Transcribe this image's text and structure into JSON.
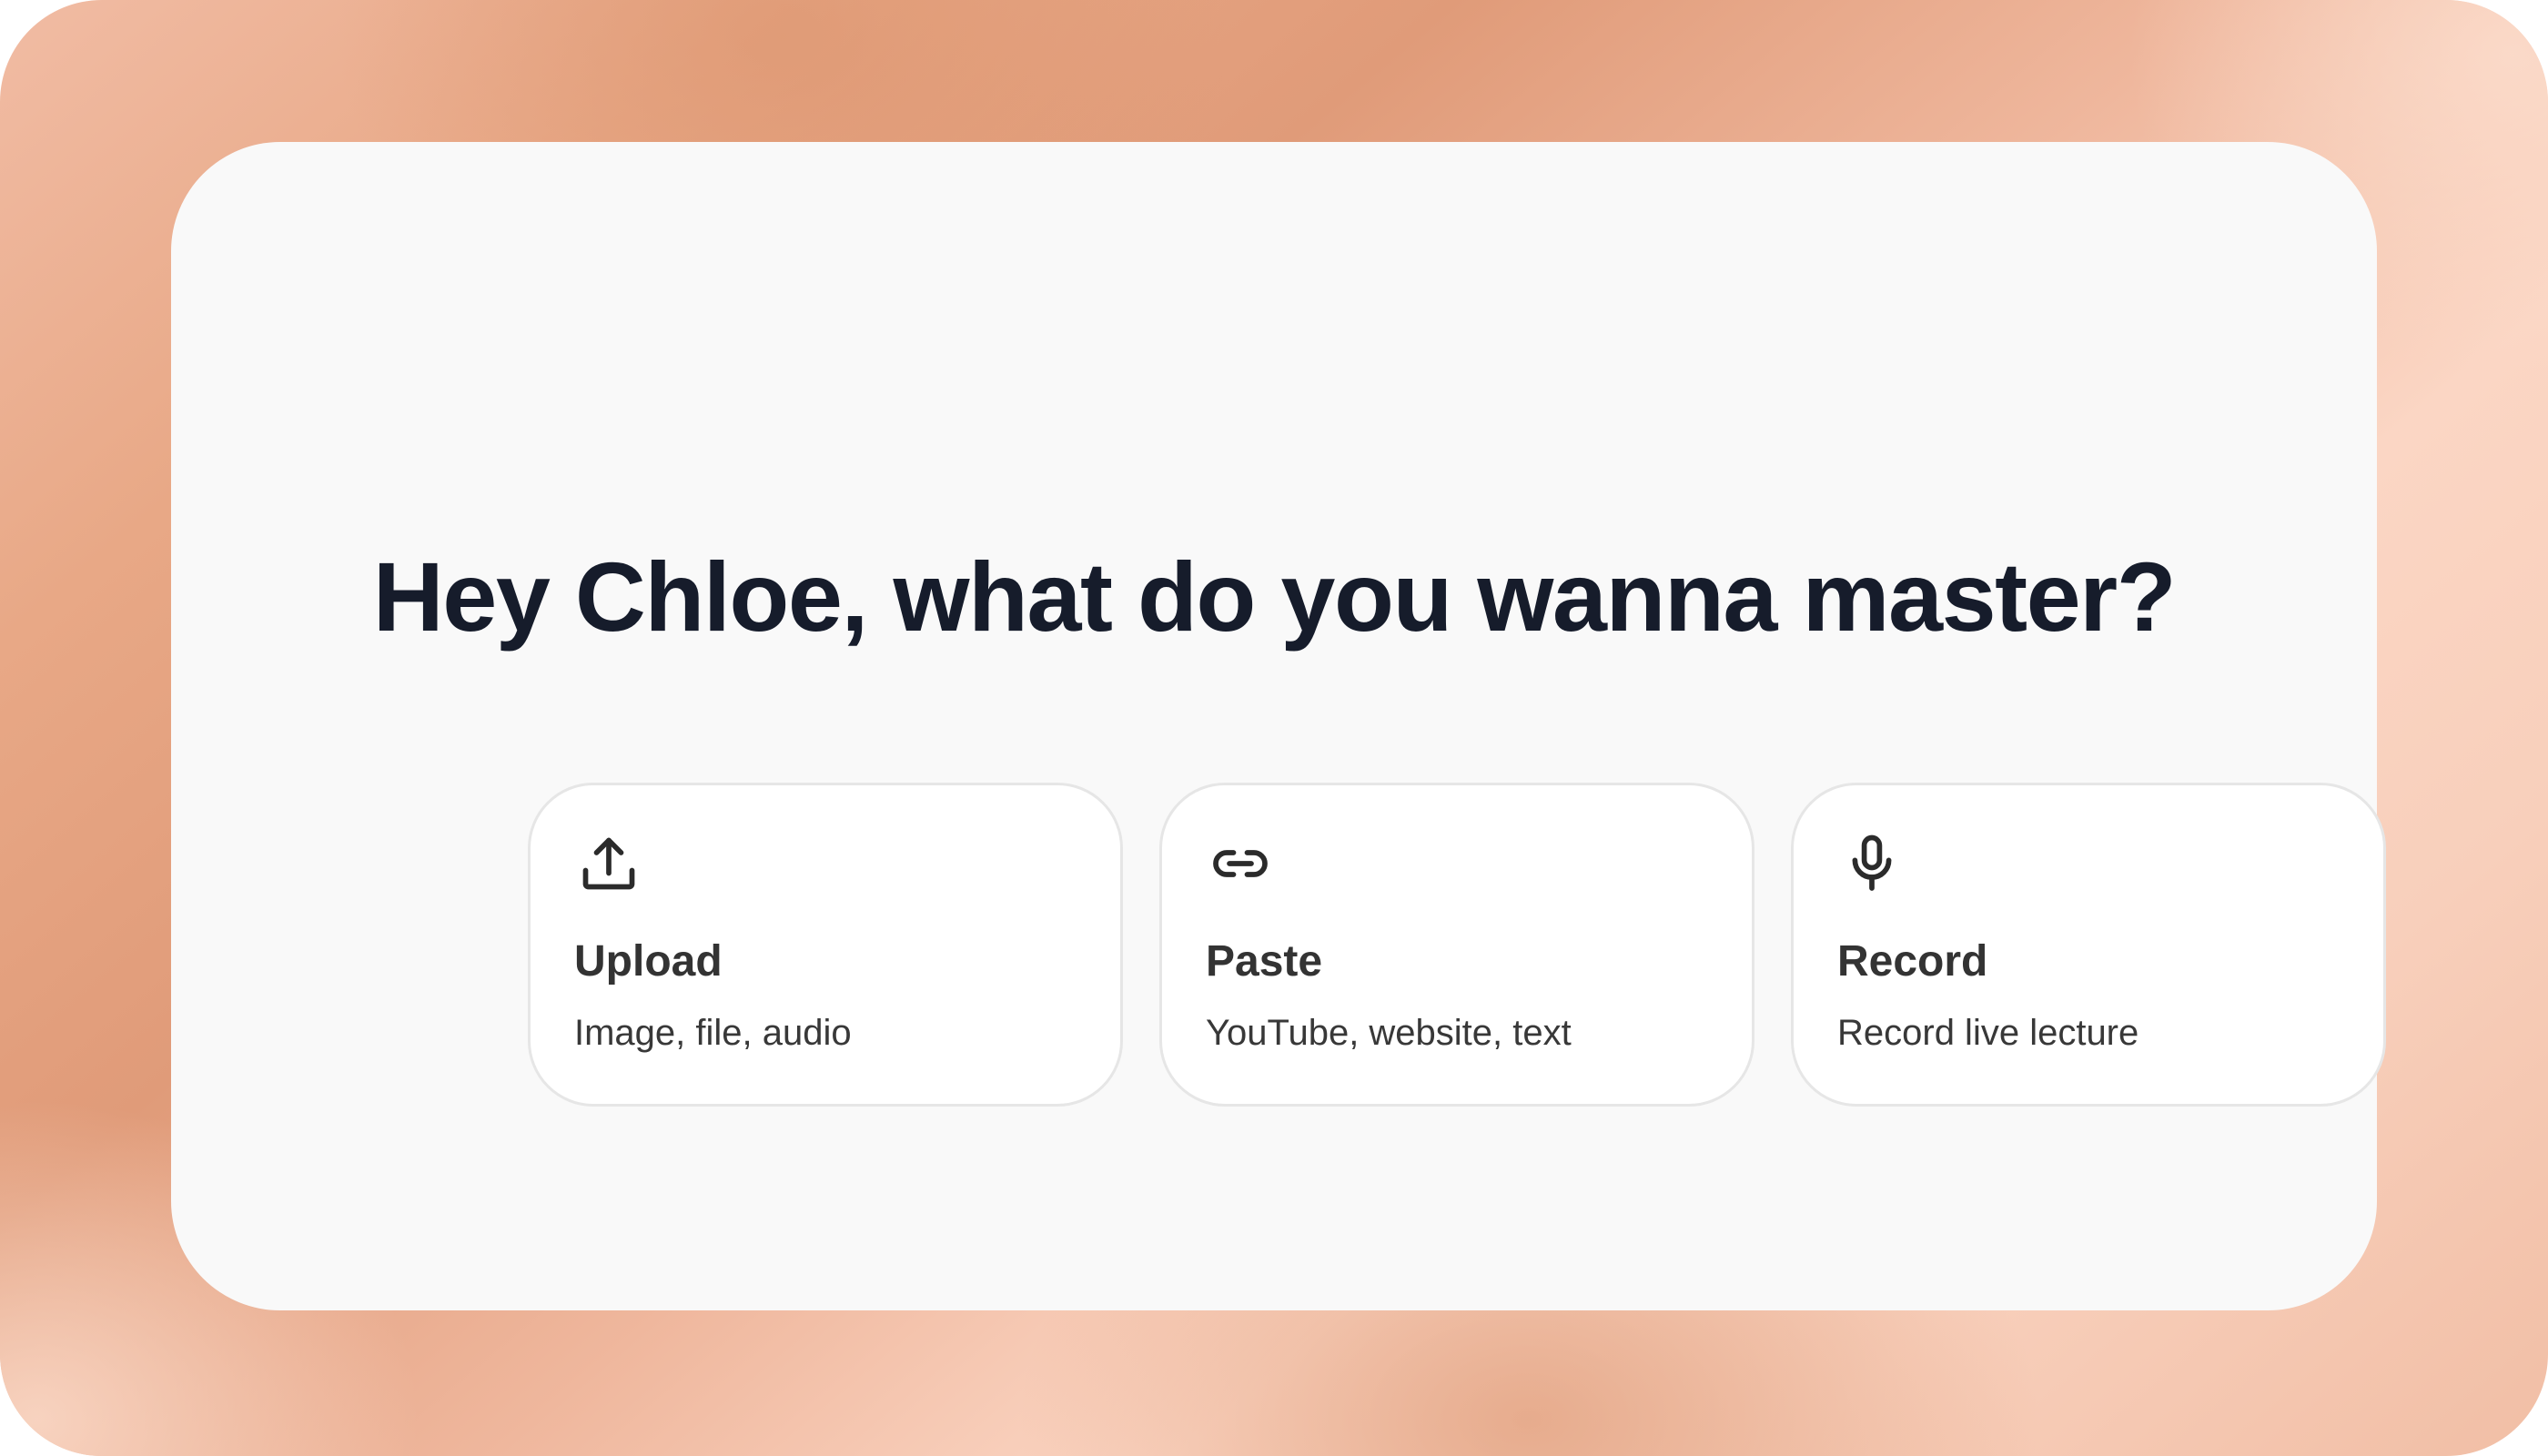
{
  "heading": "Hey Chloe, what do you wanna master?",
  "colors": {
    "panel_bg": "#f9f9f9",
    "heading_text": "#161c2b",
    "card_border": "#e6e6e6",
    "card_title": "#333333",
    "background_accent": "#e09b79"
  },
  "options": [
    {
      "icon": "upload-icon",
      "title": "Upload",
      "subtitle": "Image, file, audio"
    },
    {
      "icon": "link-icon",
      "title": "Paste",
      "subtitle": "YouTube, website, text"
    },
    {
      "icon": "microphone-icon",
      "title": "Record",
      "subtitle": "Record live lecture"
    }
  ]
}
